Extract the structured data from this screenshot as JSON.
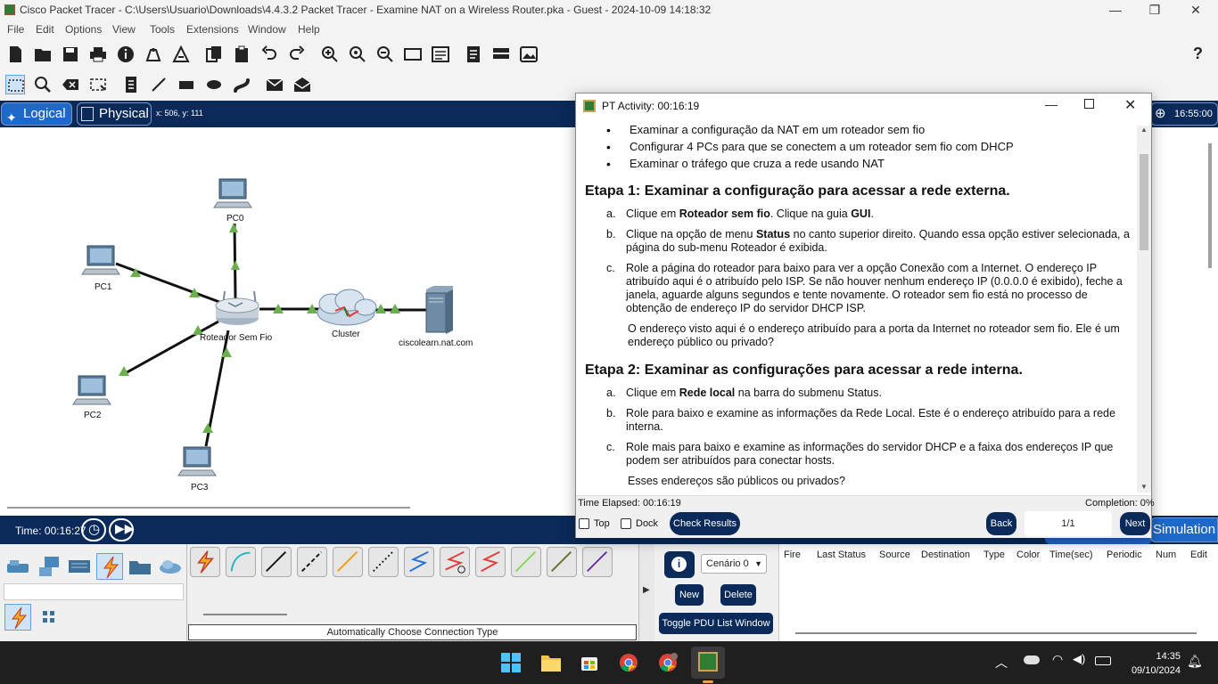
{
  "window": {
    "title": "Cisco Packet Tracer - C:\\Users\\Usuario\\Downloads\\4.4.3.2 Packet Tracer - Examine NAT on a Wireless Router.pka - Guest - 2024-10-09 14:18:32",
    "minimize": "—",
    "maximize": "❐",
    "close": "✕"
  },
  "menu": [
    "File",
    "Edit",
    "Options",
    "View",
    "Tools",
    "Extensions",
    "Window",
    "Help"
  ],
  "help_icon": "?",
  "workspace": {
    "logical_tab": "Logical",
    "physical_tab": "Physical",
    "coords": "x: 506, y: 111",
    "clock": "16:55:00"
  },
  "devices": {
    "pc0": "PC0",
    "pc1": "PC1",
    "pc2": "PC2",
    "pc3": "PC3",
    "router": "Roteador Sem Fio",
    "cluster": "Cluster",
    "server": "ciscolearn.nat.com"
  },
  "timebar": {
    "time": "Time: 00:16:27",
    "simulation": "Simulation"
  },
  "bottom": {
    "connection_label": "Automatically Choose Connection Type",
    "scenario": "Cenário 0",
    "new_btn": "New",
    "delete_btn": "Delete",
    "toggle_btn": "Toggle PDU List Window",
    "pdu_columns": [
      "Fire",
      "Last Status",
      "Source",
      "Destination",
      "Type",
      "Color",
      "Time(sec)",
      "Periodic",
      "Num",
      "Edit"
    ]
  },
  "taskbar": {
    "time": "14:35",
    "date": "09/10/2024"
  },
  "dialog": {
    "title": "PT Activity: 00:16:19",
    "bullets": [
      "Examinar a configuração da NAT em um roteador sem fio",
      "Configurar 4 PCs para que se conectem a um roteador sem fio com DHCP",
      "Examinar o tráfego que cruza a rede usando NAT"
    ],
    "etapa1": "Etapa 1: Examinar a configuração para acessar a rede externa.",
    "e1a_pre": "Clique em ",
    "e1a_b1": "Roteador sem fio",
    "e1a_mid": ". Clique na guia ",
    "e1a_b2": "GUI",
    "e1a_post": ".",
    "e1b_pre": "Clique na opção de menu ",
    "e1b_b": "Status",
    "e1b_post": " no canto superior direito. Quando essa opção estiver selecionada, a página do sub-menu Roteador é exibida.",
    "e1c": "Role a página do roteador para baixo para ver a opção Conexão com a Internet. O endereço IP atribuído aqui é o atribuído pelo ISP. Se não houver nenhum endereço IP (0.0.0.0 é exibido), feche a janela, aguarde alguns segundos e tente novamente. O roteador sem fio está no processo de obtenção de endereço IP do servidor DHCP ISP.",
    "e1q": "O endereço visto aqui é o endereço atribuído para a porta da Internet no roteador sem fio. Ele é um endereço público ou privado?",
    "etapa2": "Etapa 2: Examinar as configurações para acessar a rede interna.",
    "e2a_pre": "Clique em ",
    "e2a_b": "Rede local",
    "e2a_post": " na barra do submenu Status.",
    "e2b": "Role para baixo e examine as informações da Rede Local. Este é o endereço atribuído para a rede interna.",
    "e2c": "Role mais para baixo e examine as informações do servidor DHCP e a faixa dos endereços IP que podem ser atribuídos para conectar hosts.",
    "e2q": "Esses endereços são públicos ou privados?",
    "letters": [
      "a.",
      "b.",
      "c."
    ],
    "elapsed": "Time Elapsed: 00:16:19",
    "completion": "Completion: 0%",
    "top_label": "Top",
    "dock_label": "Dock",
    "check_results": "Check Results",
    "back": "Back",
    "page": "1/1",
    "next": "Next"
  },
  "colors": {
    "navy": "#0b2a5a",
    "tab_blue": "#1d69c9",
    "link_green": "#6ab04c"
  }
}
